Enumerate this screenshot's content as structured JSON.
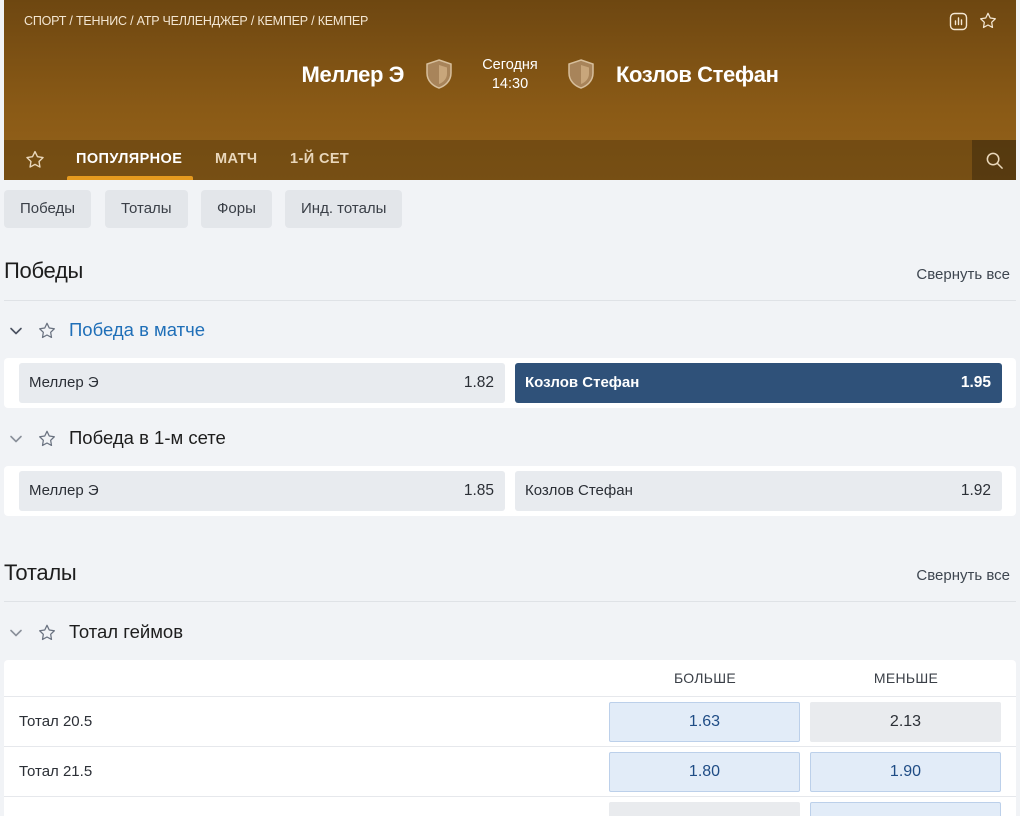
{
  "breadcrumb": "СПОРТ / ТЕННИС / ATP ЧЕЛЛЕНДЖЕР / КЕМПЕР / КЕМПЕР",
  "event": {
    "team1": "Меллер Э",
    "team2": "Козлов Стефан",
    "date_label": "Сегодня",
    "time": "14:30"
  },
  "tabs": [
    "ПОПУЛЯРНОЕ",
    "МАТЧ",
    "1-Й СЕТ"
  ],
  "filters": [
    "Победы",
    "Тоталы",
    "Форы",
    "Инд. тоталы"
  ],
  "sections": {
    "wins": {
      "title": "Победы",
      "collapse": "Свернуть все",
      "markets": [
        {
          "title": "Победа в матче",
          "odds": [
            {
              "name": "Меллер Э",
              "value": "1.82"
            },
            {
              "name": "Козлов Стефан",
              "value": "1.95"
            }
          ]
        },
        {
          "title": "Победа в 1-м сете",
          "odds": [
            {
              "name": "Меллер Э",
              "value": "1.85"
            },
            {
              "name": "Козлов Стефан",
              "value": "1.92"
            }
          ]
        }
      ]
    },
    "totals": {
      "title": "Тоталы",
      "collapse": "Свернуть все",
      "market_title": "Тотал геймов",
      "col_over": "БОЛЬШЕ",
      "col_under": "МЕНЬШЕ",
      "rows": [
        {
          "label": "Тотал 20.5",
          "over": "1.63",
          "under": "2.13"
        },
        {
          "label": "Тотал 21.5",
          "over": "1.80",
          "under": "1.90"
        }
      ]
    }
  },
  "colors": {
    "header_gradient_top": "#6e4711",
    "header_gradient_bottom": "#94621a",
    "tab_accent": "#e69a1e",
    "selected_odd": "#2f5179",
    "link": "#1f6fb8"
  }
}
